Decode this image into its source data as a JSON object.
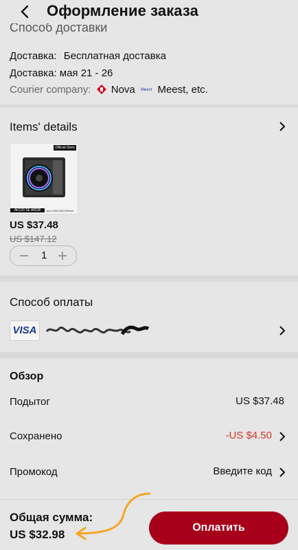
{
  "header": {
    "title": "Оформление заказа",
    "partial_text": "Способ доставки"
  },
  "delivery": {
    "type_label": "Доставка:",
    "type_value": "Бесплатная доставка",
    "date_text": "Доставка: мая 21 - 26",
    "courier_label": "Courier company:",
    "courier_1": "Nova",
    "courier_2_logo": "Meest",
    "courier_more": "Meest, etc."
  },
  "items": {
    "title": "Items' details",
    "product_caption_top": "Official Store",
    "product_caption_bottom": "AK120 SE ARGB",
    "product_size": "size:125X135X155mm",
    "price": "US $37.48",
    "old_price": "US $147.12",
    "qty": "1"
  },
  "payment": {
    "title": "Способ оплаты",
    "card_brand": "VISA"
  },
  "summary": {
    "title": "Обзор",
    "subtotal_label": "Подытог",
    "subtotal_value": "US $37.48",
    "saved_label": "Сохранено",
    "saved_value": "-US $4.50",
    "promo_label": "Промокод",
    "promo_value": "Введите код"
  },
  "footer": {
    "total_label": "Общая сумма:",
    "total_value": "US $32.98",
    "pay_label": "Оплатить"
  },
  "colors": {
    "accent": "#a8001a",
    "annotation": "#f5a623",
    "saved": "#d33a2c"
  }
}
